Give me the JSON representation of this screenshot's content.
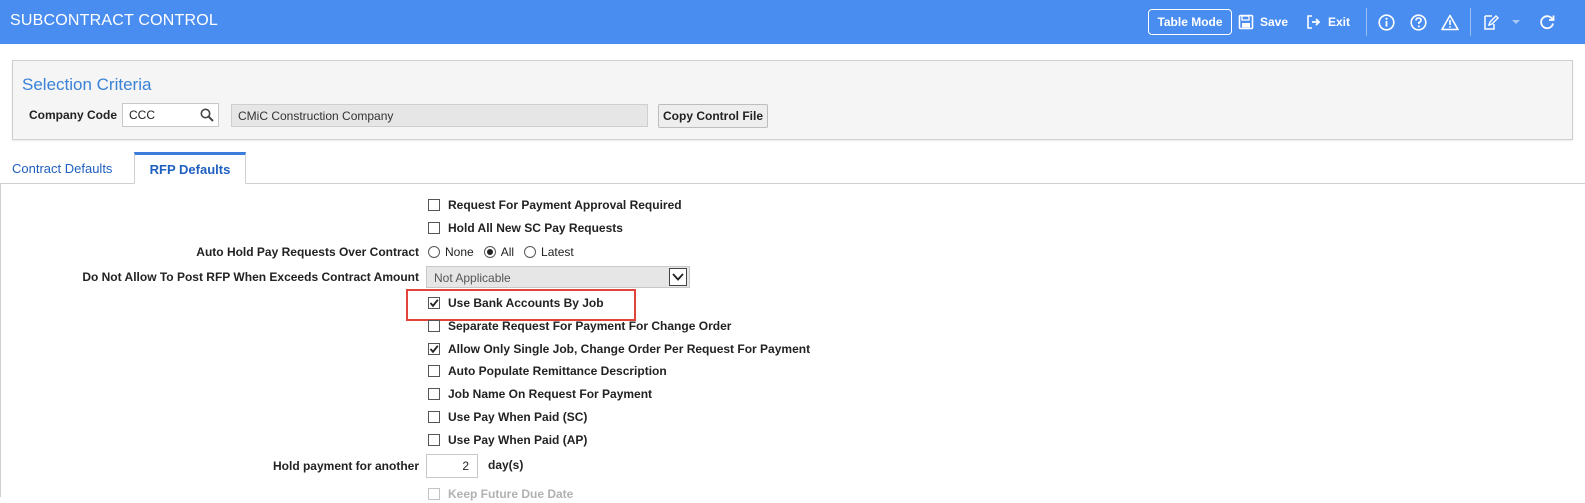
{
  "header": {
    "title": "SUBCONTRACT CONTROL",
    "table_mode": "Table Mode",
    "save": "Save",
    "exit": "Exit",
    "icons": [
      "info-icon",
      "help-icon",
      "warning-icon",
      "edit-icon",
      "chevron-down-icon",
      "refresh-icon"
    ]
  },
  "selection": {
    "title": "Selection Criteria",
    "company_code_label": "Company Code",
    "company_code_value": "CCC",
    "company_name": "CMiC Construction Company",
    "copy_button": "Copy Control File"
  },
  "tabs": [
    {
      "label": "Contract Defaults",
      "active": false
    },
    {
      "label": "RFP Defaults",
      "active": true
    }
  ],
  "form": {
    "rfp_approval_required": {
      "label": "Request For Payment Approval Required",
      "checked": false
    },
    "hold_new_sc_pay": {
      "label": "Hold All New SC Pay Requests",
      "checked": false
    },
    "auto_hold": {
      "label": "Auto Hold Pay Requests Over Contract",
      "options": [
        "None",
        "All",
        "Latest"
      ],
      "selected": "All"
    },
    "no_post_rfp": {
      "label": "Do Not Allow To Post RFP When Exceeds Contract Amount",
      "value": "Not Applicable"
    },
    "bank_accounts_by_job": {
      "label": "Use Bank Accounts By Job",
      "checked": true
    },
    "separate_rfp_change_order": {
      "label": "Separate Request For Payment For Change Order",
      "checked": false
    },
    "single_job_change_order": {
      "label": "Allow Only Single Job, Change Order Per Request For Payment",
      "checked": true
    },
    "auto_populate_remittance": {
      "label": "Auto Populate Remittance Description",
      "checked": false
    },
    "job_name_on_rfp": {
      "label": "Job Name On Request For Payment",
      "checked": false
    },
    "pay_when_paid_sc": {
      "label": "Use Pay When Paid (SC)",
      "checked": false
    },
    "pay_when_paid_ap": {
      "label": "Use Pay When Paid (AP)",
      "checked": false
    },
    "hold_payment": {
      "label": "Hold payment for another",
      "value": "2",
      "unit": "day(s)"
    },
    "keep_future_due_date": {
      "label": "Keep Future Due Date",
      "checked": false
    }
  }
}
